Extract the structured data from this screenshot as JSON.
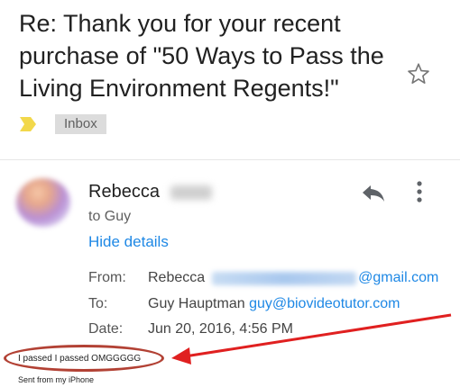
{
  "email": {
    "subject": "Re: Thank you for your recent purchase of \"50 Ways to Pass the Living Environment Regents!\"",
    "label": "Inbox",
    "sender_name": "Rebecca",
    "to_line": "to Guy",
    "hide_details": "Hide details",
    "details": {
      "from_label": "From:",
      "from_name": "Rebecca",
      "from_domain": "@gmail.com",
      "to_label": "To:",
      "to_name": "Guy Hauptman",
      "to_email": "guy@biovideotutor.com",
      "date_label": "Date:",
      "date_value": "Jun 20, 2016, 4:56 PM"
    },
    "body": "I passed I passed OMGGGGG",
    "signature": "Sent from my iPhone"
  },
  "icons": {
    "star": "star-outline-icon",
    "important": "important-marker-icon",
    "reply": "reply-icon",
    "more": "more-vert-icon"
  },
  "colors": {
    "link": "#1e88e5",
    "important_marker": "#f2d84b",
    "annotation": "#b24134",
    "arrow": "#e02020"
  }
}
